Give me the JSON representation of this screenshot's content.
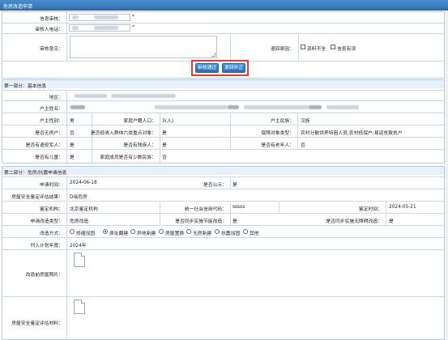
{
  "window": {
    "title": "危房改造申请"
  },
  "review": {
    "reviewer_label": "信息审核：",
    "reviewer_phone_label": "审核人电话：",
    "opinion_label": "审核意见：",
    "return_reason_label": "退回原因：",
    "return_options": [
      "资料不全",
      "信息有误"
    ],
    "approve_button": "审核通过",
    "return_button": "退回补正"
  },
  "basic": {
    "section_title": "第一部分：基本信息",
    "region_label": "地区：",
    "owner_name_label": "户主姓名：",
    "owner_gender_label": "户主性别：",
    "owner_gender": "男",
    "household_pop_label": "家庭户籍人口：",
    "household_pop": "3(人)",
    "ethnicity_label": "户主民族：",
    "ethnicity": "汉族",
    "no_house_label": "是否无房户：",
    "no_house": "否",
    "low_income_label": "是否低收入群体六类重点对象：",
    "low_income": "是",
    "assist_type_label": "保障对象类型：",
    "assist_type": "农村分散供养特困人员;农村低保户;易返贫致贫户",
    "soldier_label": "是否有退役军人：",
    "soldier": "是",
    "disabled_label": "是否有残疾人：",
    "disabled": "是",
    "elderly_label": "是否有老年人：",
    "elderly": "否",
    "children_label": "是否有儿童：",
    "children": "是",
    "minority_label": "家庭成员是否有少数民族：",
    "minority": "否"
  },
  "danger": {
    "section_title": "第二部分：危房/抗震申请信息",
    "apply_time_label": "申请时间：",
    "apply_time": "2024-06-18",
    "publicized_label": "是否公示：",
    "publicized": "是",
    "safety_result_label": "房屋安全鉴定评估结果：",
    "safety_result": "D级危房",
    "appraisal_org_label": "鉴定机构：",
    "appraisal_org": "北京鉴定机构",
    "credit_code_label": "统一社会信用代码：",
    "credit_code": "sssss",
    "appraisal_time_label": "鉴定时间：",
    "appraisal_time": "2024-05-21",
    "apply_type_label": "申请改造类型：",
    "apply_type": "危房改造",
    "energy_label": "是否同步实施节能改造：",
    "energy": "是",
    "barrier_free_label": "是否同步实施无障碍改造：",
    "barrier_free": "是",
    "method_label": "改造方式：",
    "methods": [
      "修缮加固",
      "原址翻建",
      "异地新建",
      "房屋置换",
      "无房新建",
      "抗震加固",
      "其他"
    ],
    "plan_year_label": "列入计划年度：",
    "plan_year": "2024年",
    "before_photo_label": "改造前房屋照片：",
    "safety_material_label": "房屋安全鉴定评估材料："
  },
  "colors": {
    "accent": "#2f6fb1",
    "required": "#d40000",
    "highlight": "#e53935",
    "section_bg": "#e8f1fb"
  }
}
